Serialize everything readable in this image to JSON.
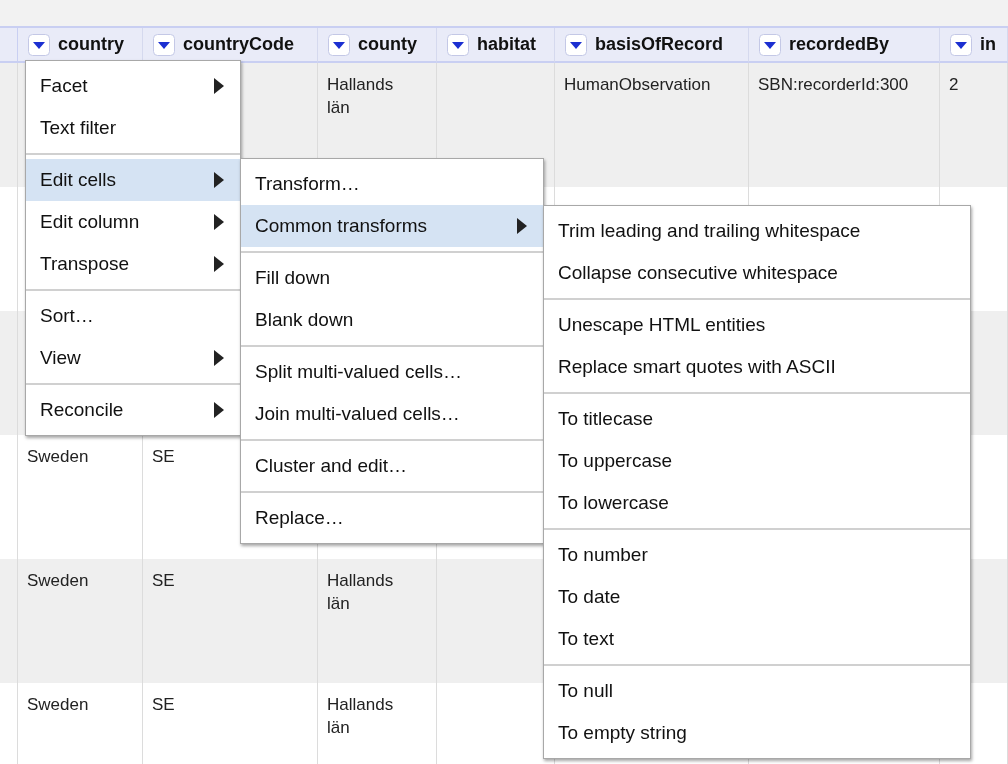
{
  "table": {
    "columns": [
      "country",
      "countryCode",
      "county",
      "habitat",
      "basisOfRecord",
      "recordedBy",
      "in"
    ],
    "rows": [
      {
        "cells": [
          null,
          null,
          "Hallands län",
          null,
          "HumanObservation",
          "SBN:recorderId:300",
          "2"
        ]
      },
      {
        "cells": [
          null,
          null,
          null,
          null,
          null,
          null,
          null
        ]
      },
      {
        "cells": [
          null,
          null,
          null,
          null,
          null,
          null,
          null
        ]
      },
      {
        "cells": [
          "Sweden",
          "SE",
          null,
          null,
          null,
          null,
          null
        ]
      },
      {
        "cells": [
          "Sweden",
          "SE",
          "Hallands län",
          null,
          null,
          null,
          null
        ]
      },
      {
        "cells": [
          "Sweden",
          "SE",
          "Hallands län",
          null,
          null,
          null,
          null
        ]
      }
    ]
  },
  "menus": [
    {
      "groups": [
        [
          {
            "label": "Facet",
            "submenu": true,
            "selected": false
          },
          {
            "label": "Text filter",
            "submenu": false,
            "selected": false
          }
        ],
        [
          {
            "label": "Edit cells",
            "submenu": true,
            "selected": true
          },
          {
            "label": "Edit column",
            "submenu": true,
            "selected": false
          },
          {
            "label": "Transpose",
            "submenu": true,
            "selected": false
          }
        ],
        [
          {
            "label": "Sort…",
            "submenu": false,
            "selected": false
          },
          {
            "label": "View",
            "submenu": true,
            "selected": false
          }
        ],
        [
          {
            "label": "Reconcile",
            "submenu": true,
            "selected": false
          }
        ]
      ]
    },
    {
      "groups": [
        [
          {
            "label": "Transform…",
            "submenu": false,
            "selected": false
          },
          {
            "label": "Common transforms",
            "submenu": true,
            "selected": true
          }
        ],
        [
          {
            "label": "Fill down",
            "submenu": false,
            "selected": false
          },
          {
            "label": "Blank down",
            "submenu": false,
            "selected": false
          }
        ],
        [
          {
            "label": "Split multi-valued cells…",
            "submenu": false,
            "selected": false
          },
          {
            "label": "Join multi-valued cells…",
            "submenu": false,
            "selected": false
          }
        ],
        [
          {
            "label": "Cluster and edit…",
            "submenu": false,
            "selected": false
          }
        ],
        [
          {
            "label": "Replace…",
            "submenu": false,
            "selected": false
          }
        ]
      ]
    },
    {
      "groups": [
        [
          {
            "label": "Trim leading and trailing whitespace",
            "submenu": false,
            "selected": false
          },
          {
            "label": "Collapse consecutive whitespace",
            "submenu": false,
            "selected": false
          }
        ],
        [
          {
            "label": "Unescape HTML entities",
            "submenu": false,
            "selected": false
          },
          {
            "label": "Replace smart quotes with ASCII",
            "submenu": false,
            "selected": false
          }
        ],
        [
          {
            "label": "To titlecase",
            "submenu": false,
            "selected": false
          },
          {
            "label": "To uppercase",
            "submenu": false,
            "selected": false
          },
          {
            "label": "To lowercase",
            "submenu": false,
            "selected": false
          }
        ],
        [
          {
            "label": "To number",
            "submenu": false,
            "selected": false
          },
          {
            "label": "To date",
            "submenu": false,
            "selected": false
          },
          {
            "label": "To text",
            "submenu": false,
            "selected": false
          }
        ],
        [
          {
            "label": "To null",
            "submenu": false,
            "selected": false
          },
          {
            "label": "To empty string",
            "submenu": false,
            "selected": false
          }
        ]
      ]
    }
  ]
}
